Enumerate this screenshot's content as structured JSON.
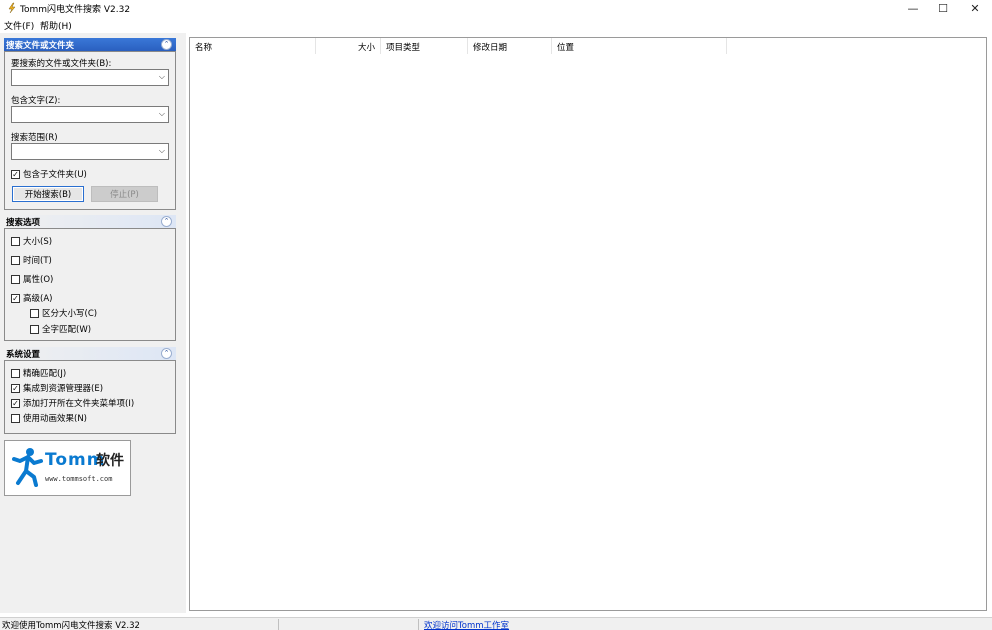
{
  "window": {
    "title": "Tomm闪电文件搜索 V2.32",
    "min_glyph": "—",
    "max_glyph": "☐",
    "close_glyph": "✕",
    "icon": "lightning-figure-icon"
  },
  "menu": {
    "items": [
      {
        "label": "文件(F)"
      },
      {
        "label": "帮助(H)"
      }
    ]
  },
  "search_panel": {
    "title": "搜索文件或文件夹",
    "collapse_glyph": "⌃",
    "name_label": "要搜索的文件或文件夹(B):",
    "name_value": "",
    "text_label": "包含文字(Z):",
    "text_value": "",
    "scope_label": "搜索范围(R)",
    "scope_value": "",
    "subfolder_label": "包含子文件夹(U)",
    "subfolder_checked": "✓",
    "start_label": "开始搜索(B)",
    "stop_label": "停止(P)"
  },
  "options_panel": {
    "title": "搜索选项",
    "collapse_glyph": "⌃",
    "items": [
      {
        "label": "大小(S)",
        "mark": ""
      },
      {
        "label": "时间(T)",
        "mark": ""
      },
      {
        "label": "属性(O)",
        "mark": ""
      },
      {
        "label": "高级(A)",
        "mark": "✓"
      },
      {
        "label": "区分大小写(C)",
        "mark": ""
      },
      {
        "label": "全字匹配(W)",
        "mark": ""
      }
    ]
  },
  "system_panel": {
    "title": "系统设置",
    "collapse_glyph": "⌃",
    "items": [
      {
        "label": "精确匹配(J)",
        "mark": ""
      },
      {
        "label": "集成到资源管理器(E)",
        "mark": "✓"
      },
      {
        "label": "添加打开所在文件夹菜单项(I)",
        "mark": "✓"
      },
      {
        "label": "使用动画效果(N)",
        "mark": ""
      }
    ]
  },
  "logo": {
    "brand": "Tomm",
    "cn": "软件",
    "url": "www.tommsoft.com",
    "icon": "running-man-icon"
  },
  "results": {
    "columns": [
      {
        "label": "名称"
      },
      {
        "label": "大小"
      },
      {
        "label": "项目类型"
      },
      {
        "label": "修改日期"
      },
      {
        "label": "位置"
      }
    ]
  },
  "status": {
    "welcome": "欢迎使用Tomm闪电文件搜索 V2.32",
    "link": "欢迎访问Tomm工作室"
  },
  "colors": {
    "accent": "#2a5fbf",
    "link": "#0033cc",
    "logo_blue": "#0a7ad0"
  }
}
